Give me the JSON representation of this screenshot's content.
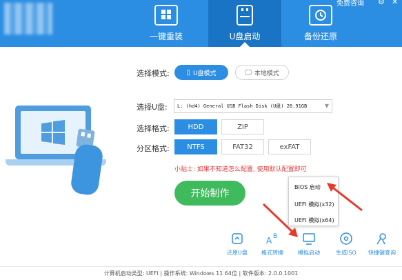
{
  "window": {
    "top_right_text": "免费咨询",
    "gear_icon": "gear-icon",
    "close_icon": "close-icon"
  },
  "tabs": [
    {
      "label": "一键重装",
      "icon": "windows-icon",
      "active": false
    },
    {
      "label": "U盘启动",
      "icon": "usb-icon",
      "active": true
    },
    {
      "label": "备份还原",
      "icon": "restore-icon",
      "active": false
    }
  ],
  "form": {
    "mode_label": "选择模式:",
    "mode_usb": "U盘模式",
    "mode_local": "本地模式",
    "drive_label": "选择U盘:",
    "drive_value": "L: (hd4) General USB Flash Disk (U盘) 26.91GB",
    "boot_label": "选择格式:",
    "boot_options": [
      "HDD",
      "ZIP"
    ],
    "fs_label": "分区格式:",
    "fs_options": [
      "NTFS",
      "FAT32",
      "exFAT"
    ],
    "tip": "小贴士: 如果不知道怎么配置, 使用默认配置即可",
    "start_button": "开始制作"
  },
  "popup": {
    "items": [
      "BIOS 启动",
      "UEFI 模拟(x32)",
      "UEFI 模拟(x64)"
    ]
  },
  "toolbar": [
    {
      "label": "还原U盘",
      "icon": "restore-usb-icon"
    },
    {
      "label": "格式转换",
      "icon": "format-convert-icon"
    },
    {
      "label": "模拟启动",
      "icon": "monitor-icon"
    },
    {
      "label": "生成ISO",
      "icon": "disc-icon"
    },
    {
      "label": "快捷键查询",
      "icon": "search-key-icon"
    }
  ],
  "footer": "计算机启动类型: UEFI | 操作系统: Windows 11 64位 | 软件版本: 2.0.0.1001",
  "colors": {
    "primary": "#2c8ee2",
    "primary_dark": "#1a74c5",
    "green": "#3fba5d",
    "tip_red": "#e23a3a",
    "arrow_red": "#e53b2c"
  }
}
